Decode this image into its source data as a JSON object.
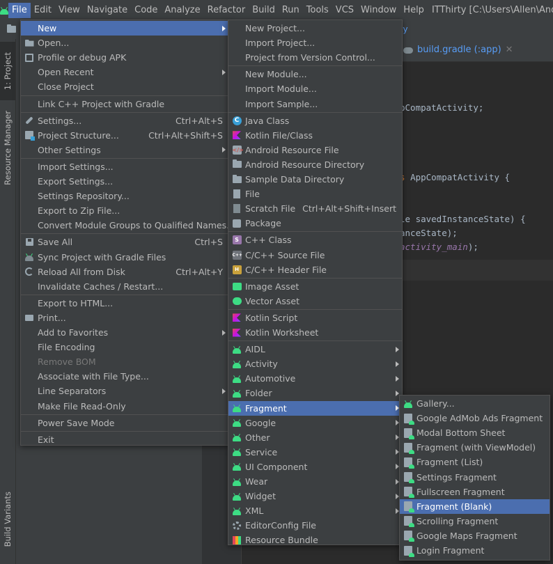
{
  "window": {
    "title": "ITThirty [C:\\Users\\Allen\\Androic"
  },
  "menubar": [
    {
      "label": "File",
      "mn": "F",
      "active": true
    },
    {
      "label": "Edit",
      "mn": "E"
    },
    {
      "label": "View",
      "mn": "V"
    },
    {
      "label": "Navigate",
      "mn": "N"
    },
    {
      "label": "Code",
      "mn": "C"
    },
    {
      "label": "Analyze",
      "mn": "z"
    },
    {
      "label": "Refactor",
      "mn": "R"
    },
    {
      "label": "Build",
      "mn": "B"
    },
    {
      "label": "Run",
      "mn": "u"
    },
    {
      "label": "Tools",
      "mn": "T"
    },
    {
      "label": "VCS",
      "mn": "S"
    },
    {
      "label": "Window",
      "mn": "W"
    },
    {
      "label": "Help",
      "mn": "H"
    }
  ],
  "breadcrumb": "ivity",
  "editor_tab": {
    "label": "build.gradle (:app)"
  },
  "sidebar": {
    "project_tab": "1: Project",
    "resource_tab": "Resource Manager",
    "build_variants_tab": "Build Variants"
  },
  "code_lines": [
    {
      "text": "pCompatActivity;"
    },
    {
      "kw": "s ",
      "text": "AppCompatActivity {"
    },
    {
      "text": "le savedInstanceState) {"
    },
    {
      "text": "anceState);"
    },
    {
      "it": "activity_main",
      "text": ");"
    }
  ],
  "file_menu": {
    "items": [
      {
        "label": "New",
        "icon": "none",
        "sub": true,
        "sel": true
      },
      {
        "label": "Open...",
        "icon": "open-icon"
      },
      {
        "label": "Profile or debug APK",
        "icon": "apk-icon"
      },
      {
        "label": "Open Recent",
        "sub": true
      },
      {
        "label": "Close Project"
      },
      {
        "sep": true
      },
      {
        "label": "Link C++ Project with Gradle"
      },
      {
        "sep": true
      },
      {
        "label": "Settings...",
        "icon": "wrench-icon",
        "shortcut": "Ctrl+Alt+S"
      },
      {
        "label": "Project Structure...",
        "icon": "project-structure-icon",
        "shortcut": "Ctrl+Alt+Shift+S"
      },
      {
        "label": "Other Settings",
        "sub": true
      },
      {
        "sep": true
      },
      {
        "label": "Import Settings..."
      },
      {
        "label": "Export Settings..."
      },
      {
        "label": "Settings Repository..."
      },
      {
        "label": "Export to Zip File..."
      },
      {
        "label": "Convert Module Groups to Qualified Names..."
      },
      {
        "sep": true
      },
      {
        "label": "Save All",
        "icon": "save-icon",
        "shortcut": "Ctrl+S"
      },
      {
        "label": "Sync Project with Gradle Files",
        "icon": "gradle-sync-icon"
      },
      {
        "label": "Reload All from Disk",
        "icon": "reload-icon",
        "shortcut": "Ctrl+Alt+Y"
      },
      {
        "label": "Invalidate Caches / Restart..."
      },
      {
        "sep": true
      },
      {
        "label": "Export to HTML..."
      },
      {
        "label": "Print...",
        "icon": "print-icon"
      },
      {
        "label": "Add to Favorites",
        "sub": true
      },
      {
        "label": "File Encoding"
      },
      {
        "label": "Remove BOM",
        "disabled": true
      },
      {
        "label": "Associate with File Type..."
      },
      {
        "label": "Line Separators",
        "sub": true
      },
      {
        "label": "Make File Read-Only"
      },
      {
        "sep": true
      },
      {
        "label": "Power Save Mode"
      },
      {
        "sep": true
      },
      {
        "label": "Exit"
      }
    ]
  },
  "new_menu": {
    "items": [
      {
        "label": "New Project..."
      },
      {
        "label": "Import Project..."
      },
      {
        "label": "Project from Version Control..."
      },
      {
        "sep": true
      },
      {
        "label": "New Module..."
      },
      {
        "label": "Import Module..."
      },
      {
        "label": "Import Sample..."
      },
      {
        "sep": true
      },
      {
        "label": "Java Class",
        "icon": "java-class-icon"
      },
      {
        "label": "Kotlin File/Class",
        "icon": "kotlin-icon"
      },
      {
        "label": "Android Resource File",
        "icon": "android-resource-file-icon"
      },
      {
        "label": "Android Resource Directory",
        "icon": "folder-icon"
      },
      {
        "label": "Sample Data Directory",
        "icon": "folder-icon"
      },
      {
        "label": "File",
        "icon": "file-icon"
      },
      {
        "label": "Scratch File",
        "icon": "scratch-file-icon",
        "shortcut": "Ctrl+Alt+Shift+Insert"
      },
      {
        "label": "Package",
        "icon": "package-icon"
      },
      {
        "sep": true
      },
      {
        "label": "C++ Class",
        "icon": "cpp-class-icon"
      },
      {
        "label": "C/C++ Source File",
        "icon": "cpp-source-icon"
      },
      {
        "label": "C/C++ Header File",
        "icon": "cpp-header-icon"
      },
      {
        "sep": true
      },
      {
        "label": "Image Asset",
        "icon": "image-asset-icon"
      },
      {
        "label": "Vector Asset",
        "icon": "vector-asset-icon"
      },
      {
        "sep": true
      },
      {
        "label": "Kotlin Script",
        "icon": "kotlin-script-icon"
      },
      {
        "label": "Kotlin Worksheet",
        "icon": "kotlin-worksheet-icon"
      },
      {
        "sep": true
      },
      {
        "label": "AIDL",
        "icon": "android-icon",
        "sub": true
      },
      {
        "label": "Activity",
        "icon": "android-icon",
        "sub": true
      },
      {
        "label": "Automotive",
        "icon": "android-icon",
        "sub": true
      },
      {
        "label": "Folder",
        "icon": "android-icon",
        "sub": true
      },
      {
        "label": "Fragment",
        "icon": "android-icon",
        "sub": true,
        "sel": true
      },
      {
        "label": "Google",
        "icon": "android-icon",
        "sub": true
      },
      {
        "label": "Other",
        "icon": "android-icon",
        "sub": true
      },
      {
        "label": "Service",
        "icon": "android-icon",
        "sub": true
      },
      {
        "label": "UI Component",
        "icon": "android-icon",
        "sub": true
      },
      {
        "label": "Wear",
        "icon": "android-icon",
        "sub": true
      },
      {
        "label": "Widget",
        "icon": "android-icon",
        "sub": true
      },
      {
        "label": "XML",
        "icon": "android-icon",
        "sub": true
      },
      {
        "label": "EditorConfig File",
        "icon": "gear-icon"
      },
      {
        "label": "Resource Bundle",
        "icon": "resource-bundle-icon"
      }
    ]
  },
  "fragment_menu": {
    "items": [
      {
        "label": "Gallery...",
        "icon": "android-icon"
      },
      {
        "label": "Google AdMob Ads Fragment",
        "icon": "fragment-icon"
      },
      {
        "label": "Modal Bottom Sheet",
        "icon": "fragment-icon"
      },
      {
        "label": "Fragment (with ViewModel)",
        "icon": "fragment-icon"
      },
      {
        "label": "Fragment (List)",
        "icon": "fragment-icon"
      },
      {
        "label": "Settings Fragment",
        "icon": "fragment-icon"
      },
      {
        "label": "Fullscreen Fragment",
        "icon": "fragment-icon"
      },
      {
        "label": "Fragment (Blank)",
        "icon": "fragment-icon",
        "sel": true
      },
      {
        "label": "Scrolling Fragment",
        "icon": "fragment-icon"
      },
      {
        "label": "Google Maps Fragment",
        "icon": "fragment-icon"
      },
      {
        "label": "Login Fragment",
        "icon": "fragment-icon"
      }
    ]
  },
  "colors": {
    "selection": "#4b6eaf",
    "menu_bg": "#3c3f41",
    "android_green": "#3ddc84",
    "editor_bg": "#2b2b2b"
  }
}
